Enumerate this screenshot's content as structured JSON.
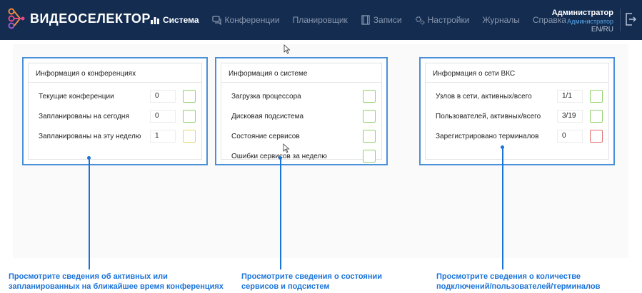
{
  "header": {
    "logo_text": "ВИДЕОСЕЛЕКТОР",
    "nav": [
      {
        "label": "Система",
        "icon": "bar-chart-icon",
        "active": true
      },
      {
        "label": "Конференции",
        "icon": "chat-bubbles-icon",
        "active": false
      },
      {
        "label": "Планировщик",
        "icon": "",
        "active": false
      },
      {
        "label": "Записи",
        "icon": "film-icon",
        "active": false
      },
      {
        "label": "Настройки",
        "icon": "gears-icon",
        "active": false
      },
      {
        "label": "Журналы",
        "icon": "",
        "active": false
      },
      {
        "label": "Справка",
        "icon": "",
        "active": false
      }
    ],
    "user": {
      "name": "Администратор",
      "role": "Администратор",
      "lang": "EN/RU"
    }
  },
  "cards": {
    "conferences": {
      "title": "Информация о конференциях",
      "rows": [
        {
          "label": "Текущие конференции",
          "value": "0",
          "status": "ok"
        },
        {
          "label": "Запланированы на сегодня",
          "value": "0",
          "status": "ok"
        },
        {
          "label": "Запланированы на эту неделю",
          "value": "1",
          "status": "warn"
        }
      ]
    },
    "system": {
      "title": "Информация о системе",
      "rows": [
        {
          "label": "Загрузка процессора",
          "status": "ok"
        },
        {
          "label": "Дисковая подсистема",
          "status": "ok"
        },
        {
          "label": "Состояние сервисов",
          "status": "ok"
        },
        {
          "label": "Ошибки сервисов за неделю",
          "status": "ok"
        }
      ]
    },
    "network": {
      "title": "Информация о сети ВКС",
      "rows": [
        {
          "label": "Узлов в сети, активных/всего",
          "value": "1/1",
          "status": "ok"
        },
        {
          "label": "Пользователей, активных/всего",
          "value": "3/19",
          "status": "ok"
        },
        {
          "label": "Зарегистрировано терминалов",
          "value": "0",
          "status": "err"
        }
      ]
    }
  },
  "captions": {
    "conferences": [
      "Просмотрите сведения об активных или",
      "запланированных на ближайшее время конференциях"
    ],
    "system": [
      "Просмотрите сведения о состоянии",
      "сервисов и подсистем"
    ],
    "network": [
      "Просмотрите сведения о количестве",
      "подключений/пользователей/терминалов"
    ]
  },
  "colors": {
    "header_bg": "#132c50",
    "accent": "#1a73d9",
    "ok": "#8fd16a",
    "warn": "#e6d56a",
    "err": "#e06a6a"
  }
}
